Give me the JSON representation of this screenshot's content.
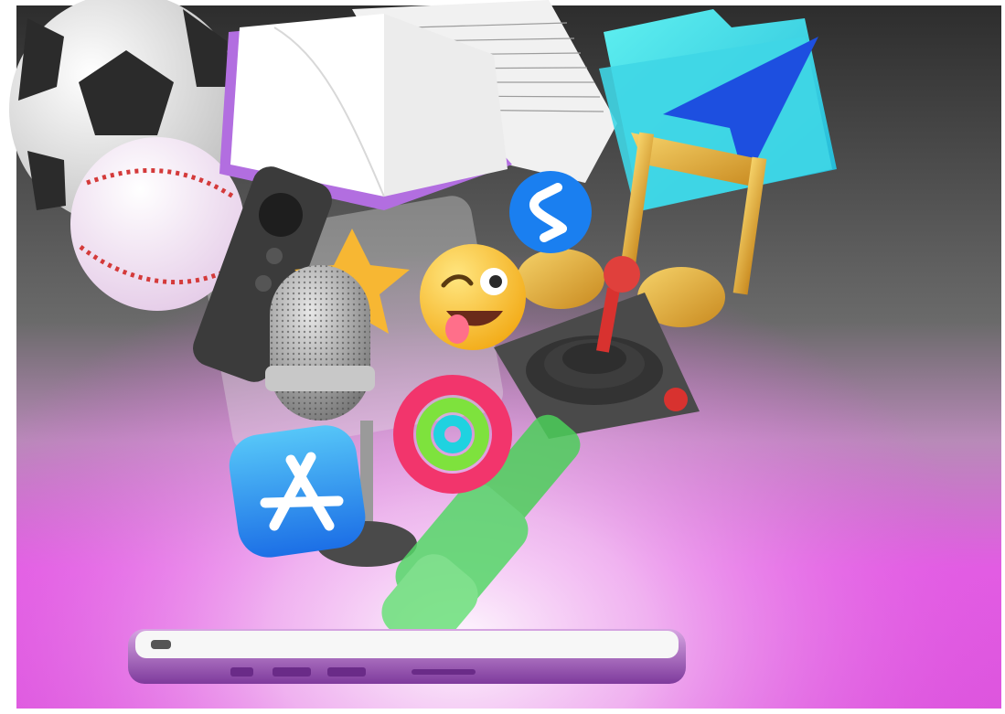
{
  "scene": {
    "colors": {
      "background_top": "#3a3a3a",
      "background_glow": "#e45ae6",
      "phone_body": "#9a4fb8",
      "screen": "#f7f7f7"
    },
    "objects": [
      "soccer-ball",
      "baseball",
      "open-book",
      "newspaper",
      "folder",
      "location-arrow",
      "apple-tv-remote",
      "star",
      "shazam-logo",
      "winking-emoji",
      "music-note",
      "microphone",
      "joystick",
      "activity-rings",
      "app-store-icon",
      "dumbbell",
      "smartphone"
    ]
  }
}
